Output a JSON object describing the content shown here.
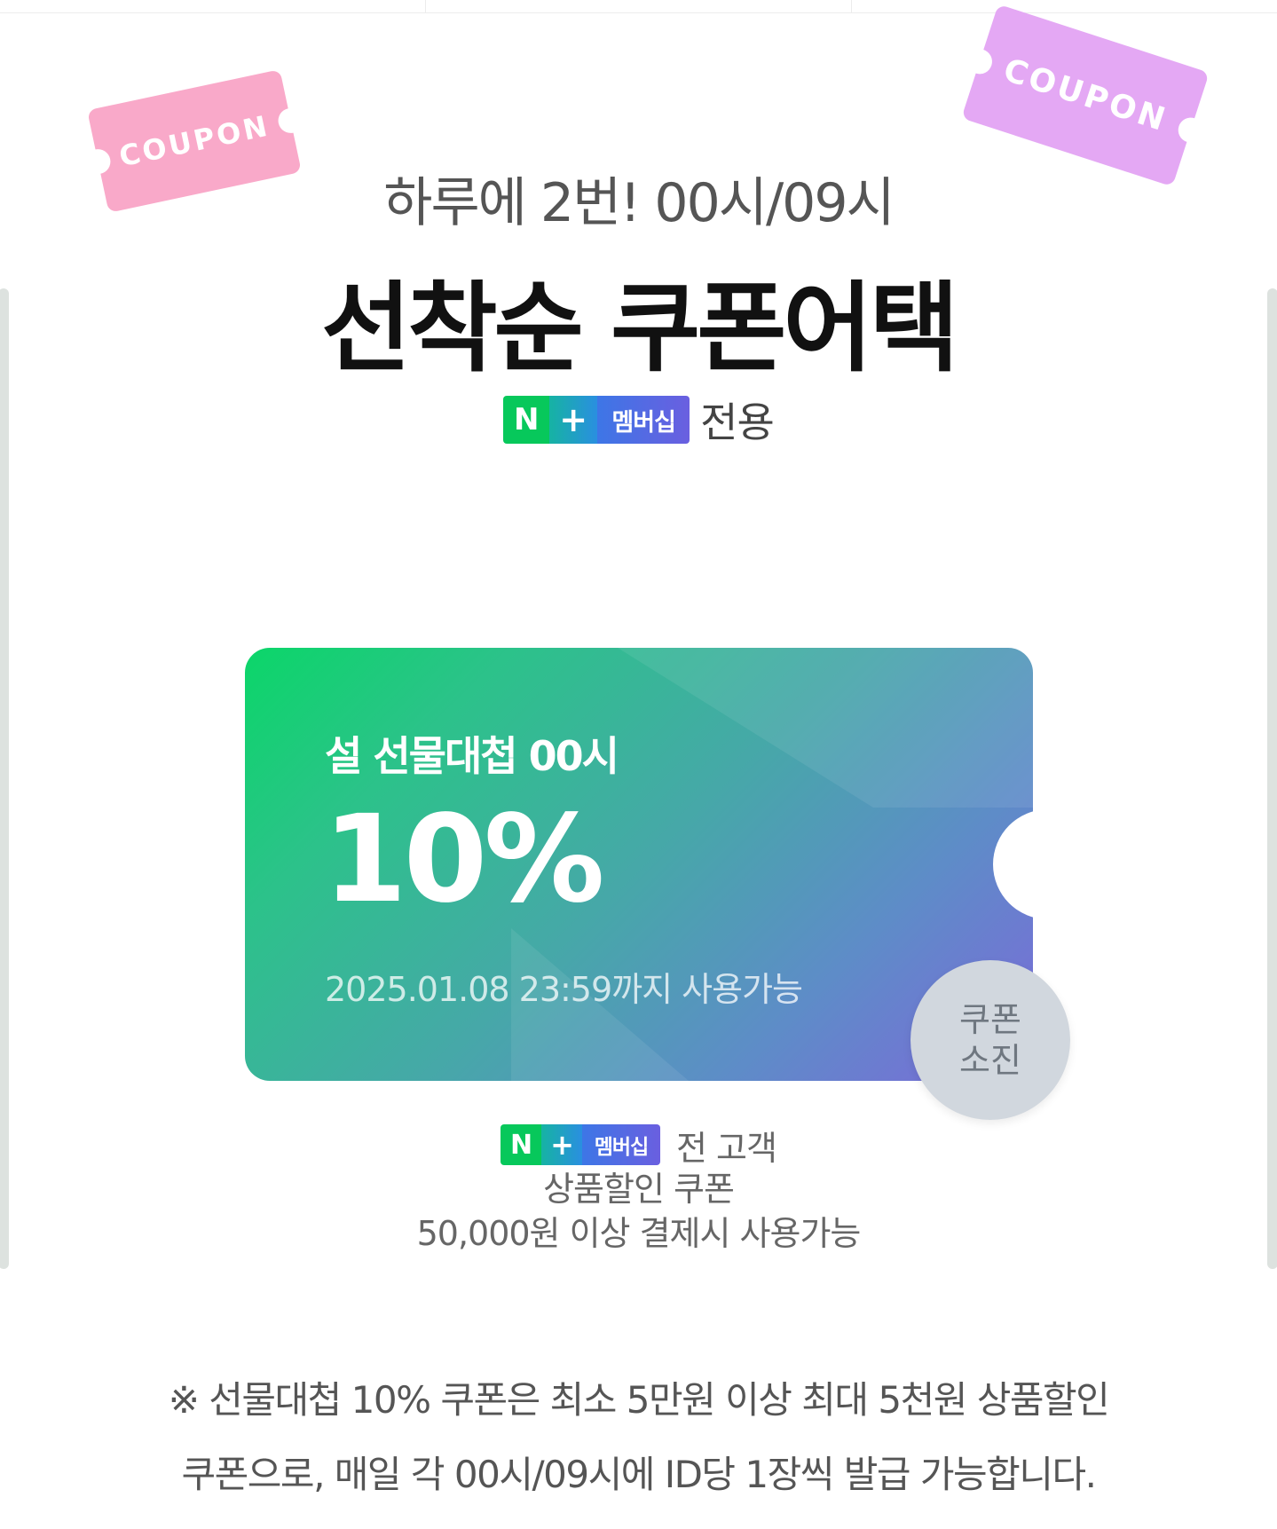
{
  "stickers": {
    "left_text": "COUPON",
    "right_text": "COUPON"
  },
  "header": {
    "subtitle": "하루에 2번! 00시/09시",
    "title": "선착순 쿠폰어택"
  },
  "membership_badge": {
    "n": "N",
    "plus": "+",
    "label": "멤버십"
  },
  "exclusive_text": "전용",
  "coupon": {
    "name": "설 선물대첩 00시",
    "rate": "10%",
    "expiry": "2025.01.08 23:59까지 사용가능",
    "status_line1": "쿠폰",
    "status_line2": "소진"
  },
  "description": {
    "audience": "전 고객",
    "type": "상품할인 쿠폰",
    "condition": "50,000원 이상 결제시 사용가능"
  },
  "notice": {
    "line1": "※ 선물대첩 10% 쿠폰은 최소 5만원 이상 최대 5천원 상품할인",
    "line2": "쿠폰으로, 매일 각 00시/09시에 ID당 1장씩 발급 가능합니다."
  },
  "colors": {
    "coupon_gradient_start": "#0bd669",
    "coupon_gradient_end": "#7d68da",
    "sticker_left": "#f9a9c9",
    "sticker_right": "#e4a8f4",
    "badge_green": "#07c85b",
    "sold_out_bg": "#d1d7de"
  }
}
